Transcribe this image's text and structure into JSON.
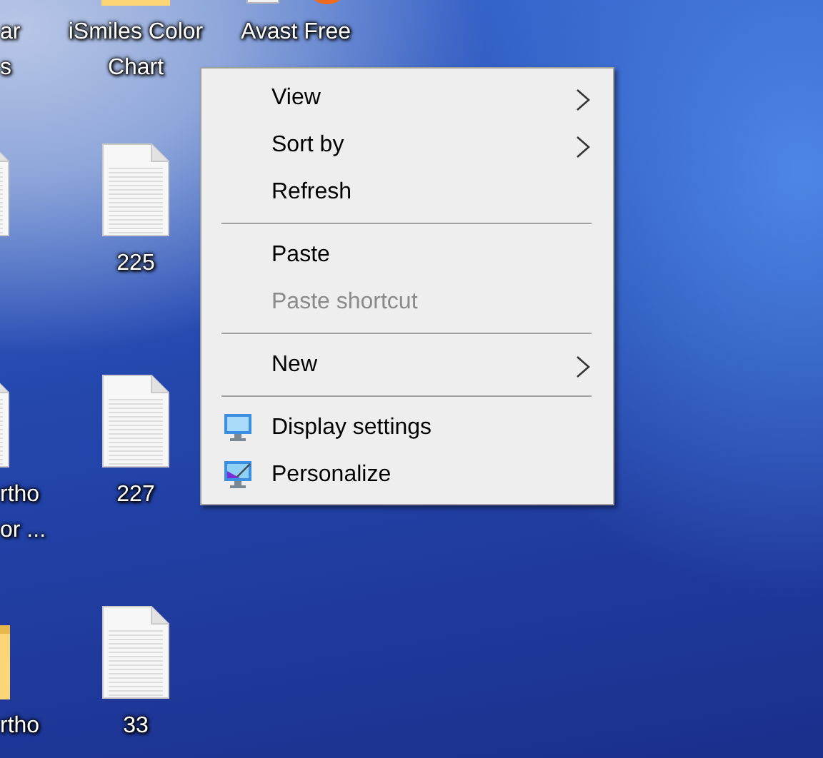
{
  "desktop": {
    "columns": [
      [
        {
          "label": "ar\ns"
        },
        {
          "kind": "document"
        },
        {
          "kind": "document",
          "label": "rtho\nor ..."
        },
        {
          "kind": "folder",
          "label": "rtho"
        }
      ],
      [
        {
          "kind": "folder",
          "label": "iSmiles Color\nChart"
        },
        {
          "kind": "document",
          "label": "225"
        },
        {
          "kind": "document",
          "label": "227"
        },
        {
          "kind": "document",
          "label": "33"
        }
      ],
      [
        {
          "kind": "app",
          "label": "Avast Free"
        }
      ]
    ]
  },
  "context_menu": {
    "items": [
      {
        "kind": "item",
        "label": "View",
        "submenu": true,
        "disabled": false
      },
      {
        "kind": "item",
        "label": "Sort by",
        "submenu": true,
        "disabled": false
      },
      {
        "kind": "item",
        "label": "Refresh",
        "submenu": false,
        "disabled": false
      },
      {
        "kind": "separator"
      },
      {
        "kind": "item",
        "label": "Paste",
        "submenu": false,
        "disabled": false
      },
      {
        "kind": "item",
        "label": "Paste shortcut",
        "submenu": false,
        "disabled": true
      },
      {
        "kind": "separator"
      },
      {
        "kind": "item",
        "label": "New",
        "submenu": true,
        "disabled": false
      },
      {
        "kind": "separator"
      },
      {
        "kind": "monitor",
        "label": "Display settings",
        "submenu": false,
        "disabled": false
      },
      {
        "kind": "monitor-brush",
        "label": "Personalize",
        "submenu": false,
        "disabled": false
      }
    ]
  }
}
